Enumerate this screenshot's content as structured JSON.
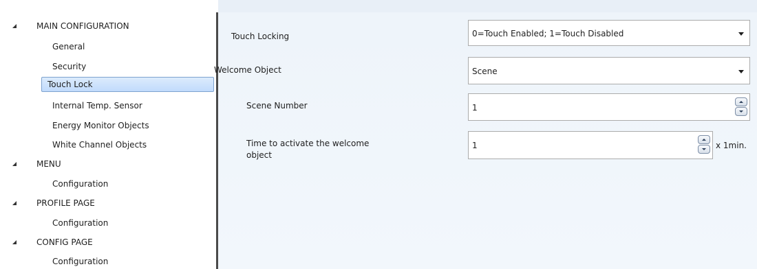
{
  "tree": {
    "sections": [
      {
        "label": "MAIN CONFIGURATION",
        "children": [
          "General",
          "Security",
          "Touch Lock",
          "Internal Temp. Sensor",
          "Energy Monitor Objects",
          "White Channel Objects"
        ]
      },
      {
        "label": "MENU",
        "children": [
          "Configuration"
        ]
      },
      {
        "label": "PROFILE PAGE",
        "children": [
          "Configuration"
        ]
      },
      {
        "label": "CONFIG PAGE",
        "children": [
          "Configuration"
        ]
      }
    ],
    "selected": "Touch Lock"
  },
  "panel": {
    "touch_locking": {
      "label": "Touch Locking",
      "value": "0=Touch Enabled; 1=Touch Disabled"
    },
    "welcome_object": {
      "label": "Welcome Object",
      "value": "Scene"
    },
    "scene_number": {
      "label": "Scene Number",
      "value": "1"
    },
    "time_to_activate": {
      "label_line1": "Time to activate the welcome",
      "label_line2": "object",
      "value": "1",
      "unit": "x 1min."
    }
  }
}
